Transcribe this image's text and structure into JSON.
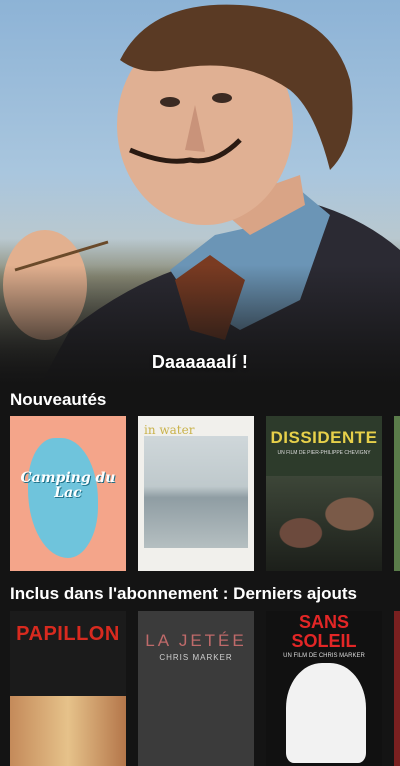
{
  "hero": {
    "title": "Daaaaaalí !"
  },
  "sections": [
    {
      "title": "Nouveautés",
      "posters": [
        {
          "title": "Camping du Lac"
        },
        {
          "title": "in water"
        },
        {
          "title": "DISSIDENTE",
          "credits": "UN FILM DE PIER-PHILIPPE CHEVIGNY"
        }
      ]
    },
    {
      "title": "Inclus dans l'abonnement : Derniers ajouts",
      "posters": [
        {
          "title": "PAPILLON"
        },
        {
          "title": "LA JETÉE",
          "credits": "CHRIS MARKER"
        },
        {
          "title": "SANS SOLEIL",
          "credits": "UN FILM DE CHRIS MARKER"
        }
      ]
    }
  ]
}
